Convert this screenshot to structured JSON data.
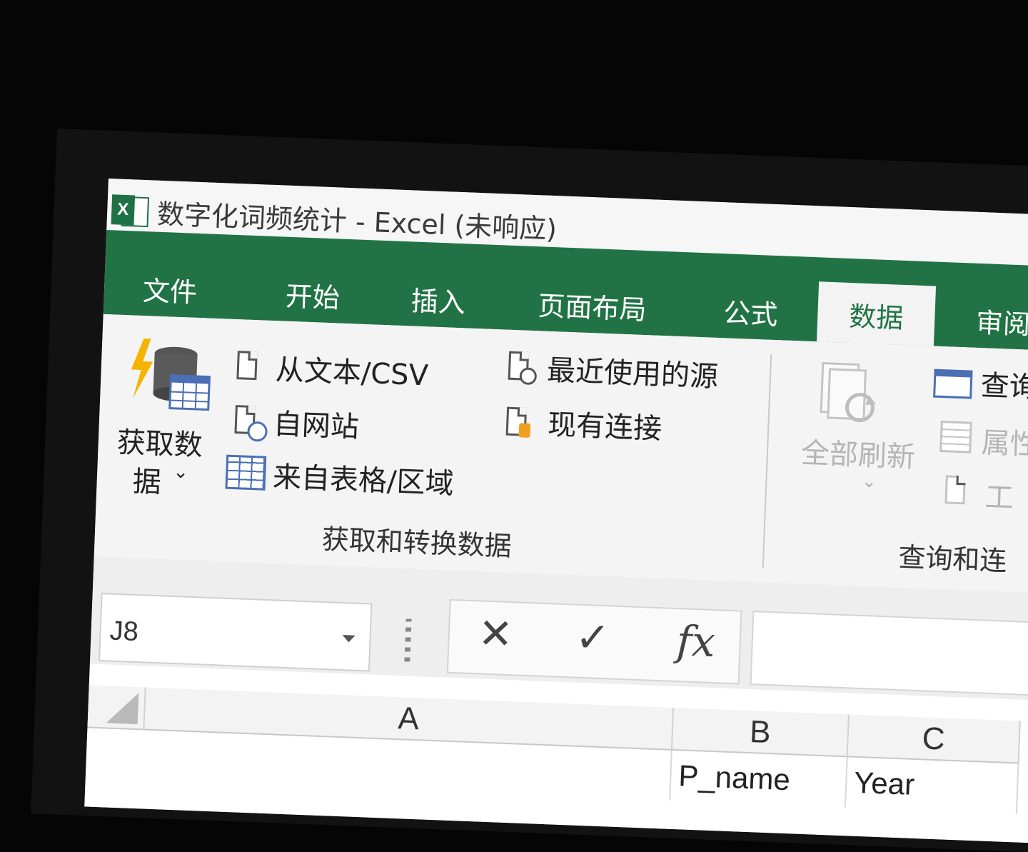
{
  "window": {
    "app_icon": "excel-icon",
    "title": "数字化词频统计 - Excel (未响应)"
  },
  "ribbon_tabs": [
    {
      "label": "文件"
    },
    {
      "label": "开始"
    },
    {
      "label": "插入"
    },
    {
      "label": "页面布局"
    },
    {
      "label": "公式"
    },
    {
      "label": "数据",
      "active": true
    },
    {
      "label": "审阅"
    }
  ],
  "get_transform_group": {
    "get_data_label_line1": "获取数",
    "get_data_label_line2": "据",
    "from_text_csv": "从文本/CSV",
    "from_web": "自网站",
    "from_table_range": "来自表格/区域",
    "recent_sources": "最近使用的源",
    "existing_connections": "现有连接",
    "group_label": "获取和转换数据"
  },
  "queries_group": {
    "refresh_all": "全部刷新",
    "queries": "查询",
    "properties": "属性",
    "edit_links": "工",
    "group_label": "查询和连"
  },
  "formula_bar": {
    "name_box": "J8",
    "cancel_symbol": "✕",
    "enter_symbol": "✓",
    "fx_symbol": "fx",
    "formula": ""
  },
  "sheet": {
    "columns": [
      "A",
      "B",
      "C"
    ],
    "row1": [
      "",
      "P_name",
      "Year"
    ]
  },
  "colors": {
    "excel_green": "#217346",
    "ribbon_bg": "#f4f4f4"
  }
}
